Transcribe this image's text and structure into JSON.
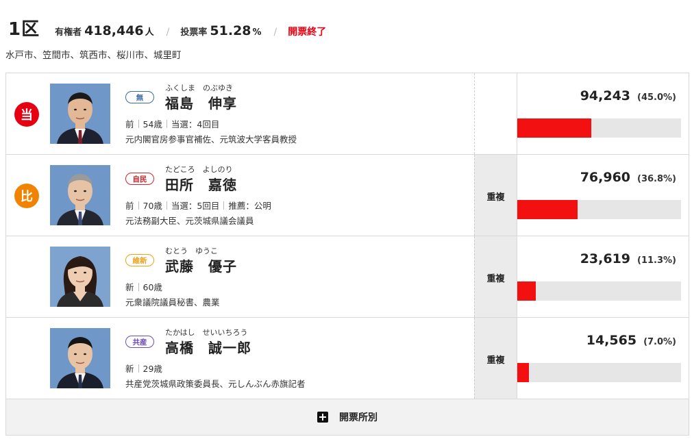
{
  "header": {
    "district": "1区",
    "electorate_label": "有権者",
    "electorate_value": "418,446",
    "electorate_unit": "人",
    "turnout_label": "投票率",
    "turnout_value": "51.28",
    "turnout_unit": "%",
    "status": "開票終了",
    "municipalities": "水戸市、笠間市、筑西市、桜川市、城里町"
  },
  "colors": {
    "accent_red": "#e60012",
    "pr_orange": "#f08300",
    "bar_red": "#f21010"
  },
  "candidates": [
    {
      "badge": "当",
      "badge_type": "win",
      "party": "無",
      "party_color": "#3d6a9e",
      "reading": "ふくしま　のぶゆき",
      "name": "福島　伸享",
      "meta": [
        "前",
        "54歳",
        "当選：4回目"
      ],
      "career": "元内閣官房参事官補佐、元筑波大学客員教授",
      "duplicate": "",
      "votes": "94,243",
      "percent": "(45.0%)",
      "share": 0.45
    },
    {
      "badge": "比",
      "badge_type": "pr",
      "party": "自民",
      "party_color": "#d2232a",
      "reading": "たどころ　よしのり",
      "name": "田所　嘉徳",
      "meta": [
        "前",
        "70歳",
        "当選：5回目",
        "推薦：公明"
      ],
      "career": "元法務副大臣、元茨城県議会議員",
      "duplicate": "重複",
      "votes": "76,960",
      "percent": "(36.8%)",
      "share": 0.368
    },
    {
      "badge": "",
      "badge_type": "",
      "party": "維新",
      "party_color": "#e9a21b",
      "reading": "むとう　ゆうこ",
      "name": "武藤　優子",
      "meta": [
        "新",
        "60歳"
      ],
      "career": "元衆議院議員秘書、農業",
      "duplicate": "重複",
      "votes": "23,619",
      "percent": "(11.3%)",
      "share": 0.113
    },
    {
      "badge": "",
      "badge_type": "",
      "party": "共産",
      "party_color": "#6e4cb8",
      "reading": "たかはし　せいいちろう",
      "name": "高橋　誠一郎",
      "meta": [
        "新",
        "29歳"
      ],
      "career": "共産党茨城県政策委員長、元しんぶん赤旗記者",
      "duplicate": "重複",
      "votes": "14,565",
      "percent": "(7.0%)",
      "share": 0.07
    }
  ],
  "footer": {
    "label": "開票所別",
    "icon": "plus-square-icon"
  }
}
